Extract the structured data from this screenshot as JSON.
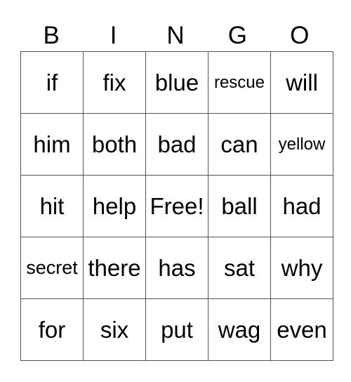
{
  "header": [
    "B",
    "I",
    "N",
    "G",
    "O"
  ],
  "rows": [
    [
      "if",
      "fix",
      "blue",
      "rescue",
      "will"
    ],
    [
      "him",
      "both",
      "bad",
      "can",
      "yellow"
    ],
    [
      "hit",
      "help",
      "Free!",
      "ball",
      "had"
    ],
    [
      "secret",
      "there",
      "has",
      "sat",
      "why"
    ],
    [
      "for",
      "six",
      "put",
      "wag",
      "even"
    ]
  ],
  "colors": {
    "grid_border": "#555555",
    "text": "#000000",
    "background": "#ffffff"
  }
}
